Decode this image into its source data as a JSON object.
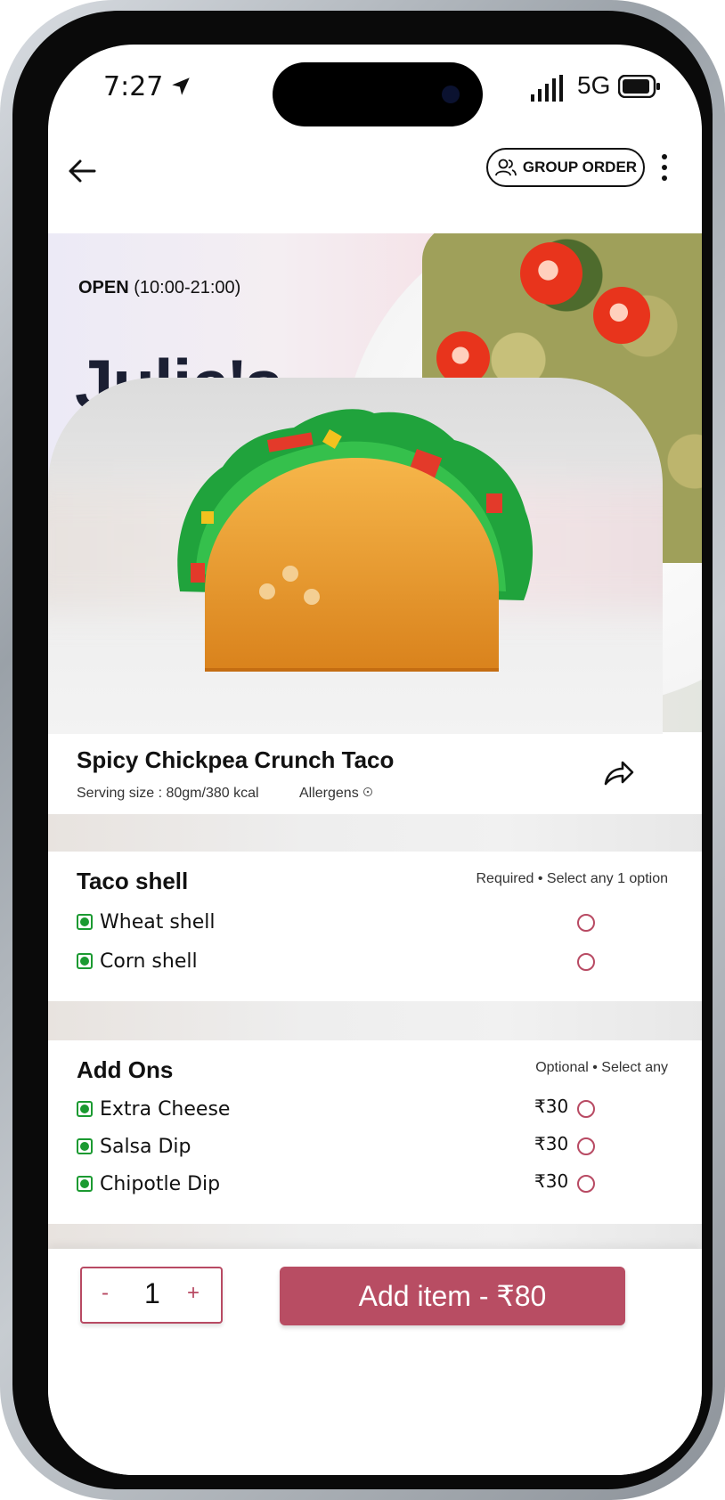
{
  "status_bar": {
    "time": "7:27",
    "network": "5G"
  },
  "header": {
    "group_order_label": "GROUP ORDER"
  },
  "restaurant": {
    "open_label": "OPEN",
    "hours": "(10:00-21:00)",
    "name": "Julie's"
  },
  "item": {
    "title": "Spicy Chickpea Crunch Taco",
    "serving": "Serving size : 80gm/380 kcal",
    "allergens_label": "Allergens"
  },
  "taco_shell": {
    "title": "Taco shell",
    "note": "Required • Select any 1 option",
    "options": [
      {
        "label": "Wheat shell"
      },
      {
        "label": "Corn shell"
      }
    ]
  },
  "add_ons": {
    "title": "Add Ons",
    "note": "Optional • Select any",
    "options": [
      {
        "label": "Extra Cheese",
        "price": "₹30"
      },
      {
        "label": "Salsa Dip",
        "price": "₹30"
      },
      {
        "label": "Chipotle Dip",
        "price": "₹30"
      }
    ]
  },
  "footer": {
    "minus": "-",
    "quantity": "1",
    "plus": "+",
    "add_label": "Add item - ₹80"
  },
  "colors": {
    "accent": "#b84d63",
    "veg": "#1b9a31"
  }
}
